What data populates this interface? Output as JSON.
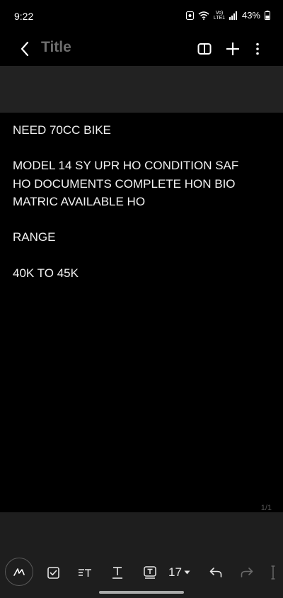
{
  "status_bar": {
    "time": "9:22",
    "volte_label_top": "Vo)",
    "volte_label_bottom": "LTE1",
    "battery": "43%"
  },
  "header": {
    "title": "Title"
  },
  "note": {
    "lines": [
      "NEED 70CC BIKE",
      "",
      "MODEL 14 SY UPR HO CONDITION SAF",
      "HO DOCUMENTS COMPLETE HON BIO",
      "MATRIC AVAILABLE HO",
      "",
      "RANGE",
      "",
      "40K TO 45K"
    ],
    "page_indicator": "1/1"
  },
  "toolbar": {
    "font_size": "17"
  },
  "colors": {
    "background": "#000000",
    "band": "#222222",
    "bottom_area": "#1e1e1e",
    "title_gray": "#6e6e6e"
  }
}
